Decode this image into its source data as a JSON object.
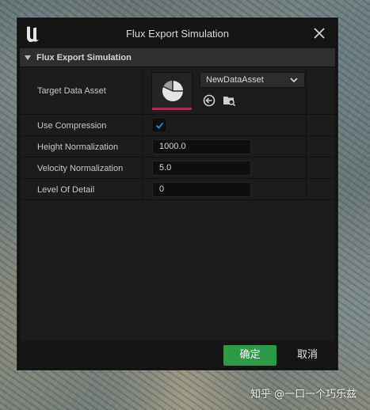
{
  "window": {
    "title": "Flux Export Simulation",
    "close_icon": "close-icon",
    "logo_icon": "unreal-logo-icon"
  },
  "section": {
    "title": "Flux Export Simulation",
    "expanded": true
  },
  "properties": {
    "target_data_asset": {
      "label": "Target Data Asset",
      "value": "NewDataAsset",
      "thumbnail_icon": "data-asset-pie-icon",
      "browse_icons": [
        "use-selected-asset-icon",
        "browse-to-asset-icon"
      ]
    },
    "use_compression": {
      "label": "Use Compression",
      "checked": true
    },
    "height_normalization": {
      "label": "Height Normalization",
      "value": "1000.0"
    },
    "velocity_normalization": {
      "label": "Velocity Normalization",
      "value": "5.0"
    },
    "level_of_detail": {
      "label": "Level Of Detail",
      "value": "0"
    }
  },
  "footer": {
    "confirm_label": "确定",
    "cancel_label": "取消"
  },
  "colors": {
    "confirm_green": "#2d9a47",
    "thumbnail_accent": "#b0295a",
    "checkbox_blue": "#2a7fd4"
  },
  "watermark": {
    "text": "知乎 @一口一个巧乐兹"
  }
}
